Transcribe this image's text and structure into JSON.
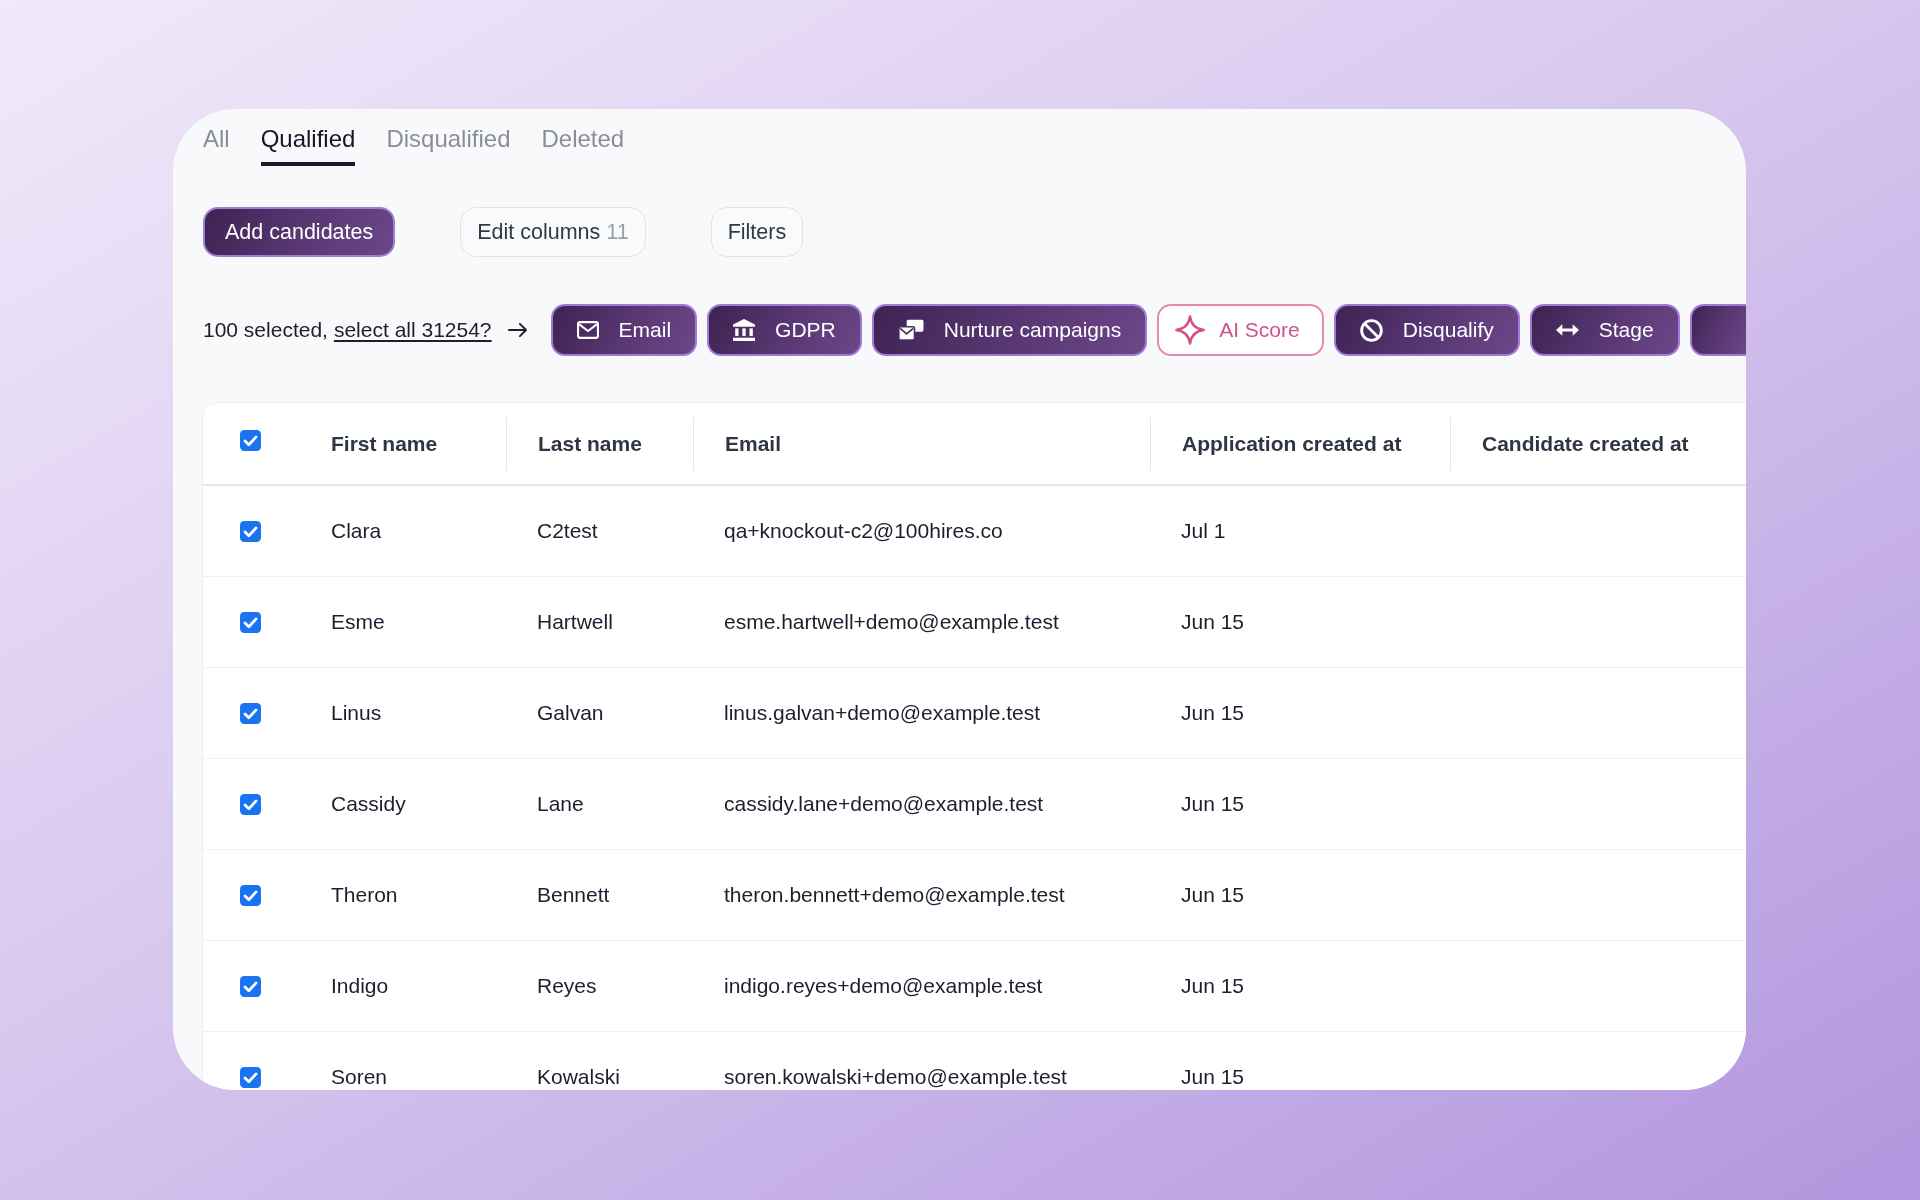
{
  "tabs": [
    {
      "label": "All",
      "selected": false
    },
    {
      "label": "Qualified",
      "selected": true
    },
    {
      "label": "Disqualified",
      "selected": false
    },
    {
      "label": "Deleted",
      "selected": false
    }
  ],
  "toolbar": [
    {
      "kind": "primary",
      "label": "Add candidates"
    },
    {
      "kind": "secondary",
      "label": "Edit columns",
      "count": "11"
    },
    {
      "kind": "secondary",
      "label": "Filters"
    }
  ],
  "selection": {
    "summary": "100 selected,",
    "link": "select all 31254?"
  },
  "actions": [
    {
      "kind": "email",
      "label": "Email"
    },
    {
      "kind": "gdpr",
      "label": "GDPR"
    },
    {
      "kind": "campaigns",
      "label": "Nurture campaigns"
    },
    {
      "kind": "ai",
      "label": "AI Score"
    },
    {
      "kind": "disqualify",
      "label": "Disqualify"
    },
    {
      "kind": "stage",
      "label": "Stage"
    },
    {
      "kind": "partial"
    }
  ],
  "table": {
    "select_all": {
      "checked": true
    },
    "columns": [
      "First name",
      "Last name",
      "Email",
      "Application created at",
      "Candidate created at"
    ],
    "rows": [
      {
        "checked": true,
        "cells": [
          "Clara",
          "C2test",
          "qa+knockout-c2@100hires.co",
          "Jul 1"
        ]
      },
      {
        "checked": true,
        "cells": [
          "Esme",
          "Hartwell",
          "esme.hartwell+demo@example.test",
          "Jun 15"
        ]
      },
      {
        "checked": true,
        "cells": [
          "Linus",
          "Galvan",
          "linus.galvan+demo@example.test",
          "Jun 15"
        ]
      },
      {
        "checked": true,
        "cells": [
          "Cassidy",
          "Lane",
          "cassidy.lane+demo@example.test",
          "Jun 15"
        ]
      },
      {
        "checked": true,
        "cells": [
          "Theron",
          "Bennett",
          "theron.bennett+demo@example.test",
          "Jun 15"
        ]
      },
      {
        "checked": true,
        "cells": [
          "Indigo",
          "Reyes",
          "indigo.reyes+demo@example.test",
          "Jun 15"
        ]
      },
      {
        "checked": true,
        "cells": [
          "Soren",
          "Kowalski",
          "soren.kowalski+demo@example.test",
          "Jun 15"
        ]
      }
    ]
  }
}
